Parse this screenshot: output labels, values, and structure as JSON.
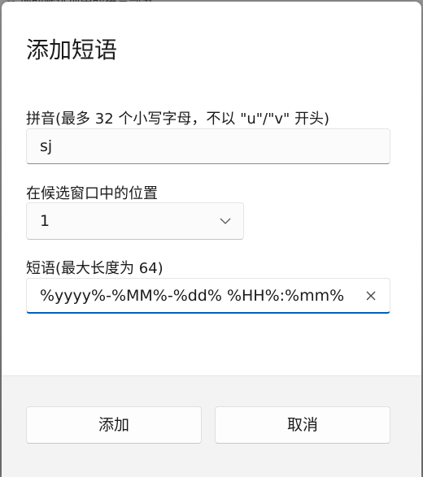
{
  "background": {
    "partial_text": "-- 词的候选项中的拼音部分"
  },
  "dialog": {
    "title": "添加短语",
    "pinyin": {
      "label": "拼音(最多 32 个小写字母，不以 \"u\"/\"v\" 开头)",
      "value": "sj"
    },
    "position": {
      "label": "在候选窗口中的位置",
      "selected": "1"
    },
    "phrase": {
      "label": "短语(最大长度为 64)",
      "value": "%yyyy%-%MM%-%dd% %HH%:%mm%"
    },
    "buttons": {
      "add": "添加",
      "cancel": "取消"
    }
  },
  "colors": {
    "accent": "#005fb8",
    "footer": "#f3f3f3"
  }
}
